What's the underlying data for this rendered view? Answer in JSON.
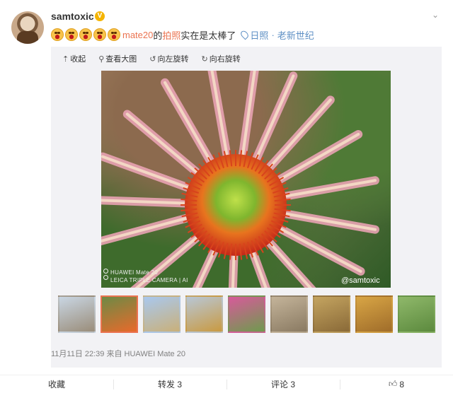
{
  "author": {
    "name": "samtoxic",
    "verified_mark": "V"
  },
  "menu_icon": "chevron-down-icon",
  "post": {
    "emoji_count": 5,
    "topic": "mate20",
    "text_part1": "的",
    "highlight": "拍照",
    "text_part2": "实在是太棒了",
    "location": "日照",
    "separator": "·",
    "source": "老新世纪"
  },
  "toolbar": {
    "collapse": "收起",
    "view_large": "查看大图",
    "rotate_left": "向左旋转",
    "rotate_right": "向右旋转"
  },
  "photo": {
    "camera_line1": "HUAWEI Mate 20",
    "camera_line2": "LEICA TRIPLE CAMERA | AI",
    "watermark": "@samtoxic"
  },
  "thumbnails": [
    {
      "colors": [
        "#c9d6e3",
        "#9a8d7a"
      ]
    },
    {
      "colors": [
        "#6d8a45",
        "#e86a2b"
      ],
      "selected": true
    },
    {
      "colors": [
        "#a9c8ee",
        "#c9b07a"
      ]
    },
    {
      "colors": [
        "#b8c7d6",
        "#c99a42"
      ]
    },
    {
      "colors": [
        "#d75a9a",
        "#6f9a4e"
      ]
    },
    {
      "colors": [
        "#c4b49a",
        "#8a7a62"
      ]
    },
    {
      "colors": [
        "#c4a460",
        "#8a6a38"
      ]
    },
    {
      "colors": [
        "#d8a545",
        "#a06d2a"
      ]
    },
    {
      "colors": [
        "#8fb86a",
        "#5c8a3e"
      ]
    }
  ],
  "meta": {
    "date": "11月11日 22:39",
    "from_label": "来自",
    "device": "HUAWEI Mate 20"
  },
  "actions": {
    "favorite": "收藏",
    "repost": "转发 3",
    "comment": "评论 3",
    "like": "8"
  }
}
